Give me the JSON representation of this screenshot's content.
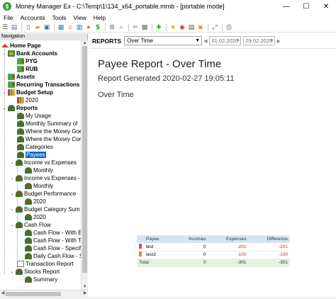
{
  "window": {
    "title": "Money Manager Ex - C:\\Temp\\1\\134_x64_portable.mmb - [portable mode]",
    "controls": [
      "—",
      "☐",
      "✕"
    ]
  },
  "menu": [
    "File",
    "Accounts",
    "Tools",
    "View",
    "Help"
  ],
  "navigation": {
    "header": "Navigation",
    "items": [
      {
        "label": "Home Page",
        "bold": true
      },
      {
        "label": "Bank Accounts",
        "bold": true
      },
      {
        "label": "PYG",
        "bold": true
      },
      {
        "label": "RUB",
        "bold": true
      },
      {
        "label": "Assets",
        "bold": true
      },
      {
        "label": "Recurring Transactions",
        "bold": true
      },
      {
        "label": "Budget Setup",
        "bold": true
      },
      {
        "label": "2020"
      },
      {
        "label": "Reports",
        "bold": true
      },
      {
        "label": "My Usage"
      },
      {
        "label": "Monthly Summary of"
      },
      {
        "label": "Where the Money Goe"
      },
      {
        "label": "Where the Money Cor"
      },
      {
        "label": "Categories"
      },
      {
        "label": "Payees",
        "selected": true
      },
      {
        "label": "Income vs Expenses"
      },
      {
        "label": "Monthly"
      },
      {
        "label": "Income vs Expenses - '"
      },
      {
        "label": "Monthly"
      },
      {
        "label": "Budget Performance"
      },
      {
        "label": "2020"
      },
      {
        "label": "Budget Category Sum"
      },
      {
        "label": "2020"
      },
      {
        "label": "Cash Flow"
      },
      {
        "label": "Cash Flow - With E"
      },
      {
        "label": "Cash Flow - With T"
      },
      {
        "label": "Cash Flow - Specif"
      },
      {
        "label": "Daily Cash Flow - S"
      },
      {
        "label": "Transaction Report"
      },
      {
        "label": "Stocks Report"
      },
      {
        "label": "Summary"
      }
    ]
  },
  "reports_bar": {
    "label": "REPORTS",
    "period": "Over Time",
    "date_from": "01.02.2020",
    "date_to": "29.02.2020"
  },
  "report": {
    "title": "Payee Report - Over Time",
    "generated": "Report Generated 2020-02-27 19:05:11",
    "subtitle": "Over Time",
    "table": {
      "headers": [
        "Payee",
        "Incomes",
        "Expenses",
        "Difference"
      ],
      "rows": [
        {
          "payee": "test",
          "incomes": "0",
          "expenses": "-201",
          "difference": "-201",
          "color": "#d9534f"
        },
        {
          "payee": "test2",
          "incomes": "0",
          "expenses": "-100",
          "difference": "-100",
          "color": "#e8853a"
        }
      ],
      "total": {
        "label": "Total:",
        "incomes": "0",
        "expenses": "-301",
        "difference": "-301"
      }
    }
  }
}
